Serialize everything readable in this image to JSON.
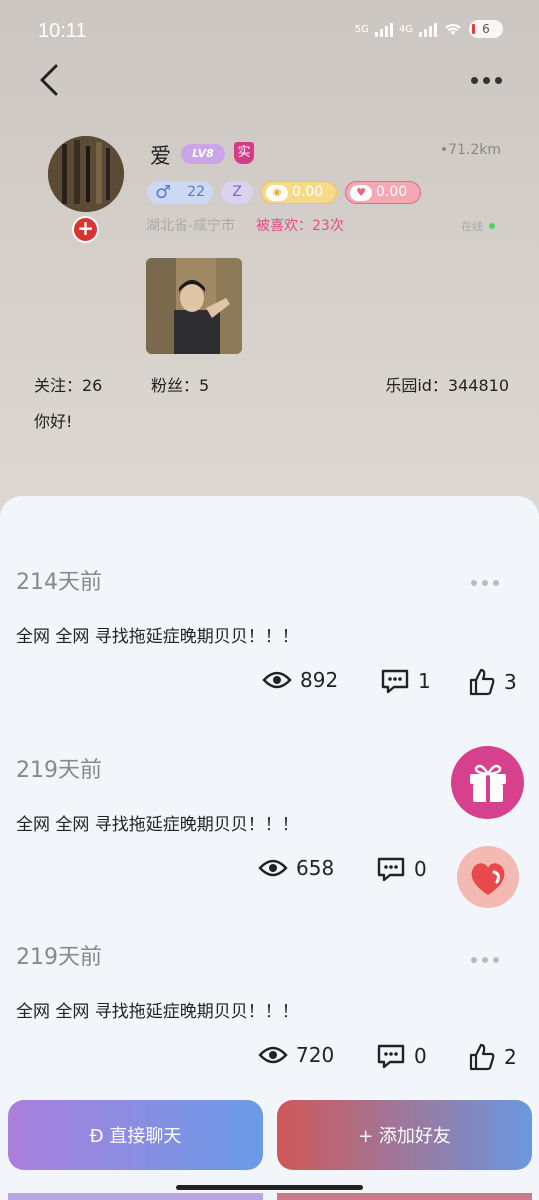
{
  "status_bar": {
    "time": "10:11",
    "net1": "5G",
    "net2": "4G",
    "battery": "6"
  },
  "profile": {
    "name": "爱",
    "level_badge": "LV8",
    "verified_badge": "实",
    "distance": "•71.2km",
    "age": "22",
    "gender_symbol": "♂",
    "zodiac": "Z",
    "gold_value": "0.00",
    "heart_value": "0.00",
    "location": "湖北省-咸宁市",
    "liked": "被喜欢：23次",
    "online": "在线",
    "follow": "关注：26",
    "fans": "粉丝：5",
    "park_id": "乐园id：344810",
    "bio": "你好!"
  },
  "posts": [
    {
      "time": "214天前",
      "text": "全网 全网 寻找拖延症晚期贝贝！！！",
      "views": "892",
      "comments": "1",
      "likes": "3"
    },
    {
      "time": "219天前",
      "text": "全网 全网 寻找拖延症晚期贝贝！！！",
      "views": "658",
      "comments": "0",
      "likes": ""
    },
    {
      "time": "219天前",
      "text": "全网 全网 寻找拖延症晚期贝贝！！！",
      "views": "720",
      "comments": "0",
      "likes": "2"
    }
  ],
  "buttons": {
    "chat": "Ð 直接聊天",
    "add_friend": "+ 添加好友"
  },
  "icons": {
    "back": "chevron-left-icon",
    "more": "more-dots-icon",
    "view": "eye-icon",
    "comment": "comment-icon",
    "like": "thumbs-up-icon",
    "gift": "gift-icon",
    "heart": "heart-icon"
  },
  "colors": {
    "accent_pink": "#d6408c",
    "liked_text": "#e14d8a",
    "online_dot": "#46d46a"
  }
}
